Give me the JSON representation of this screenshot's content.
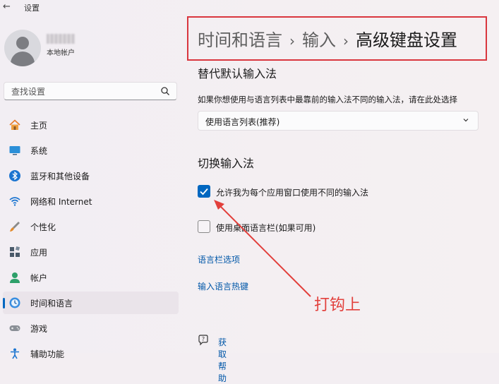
{
  "window": {
    "title": "设置"
  },
  "account": {
    "name": "",
    "type": "本地帐户"
  },
  "search": {
    "placeholder": "查找设置"
  },
  "sidebar": {
    "items": [
      {
        "label": "主页"
      },
      {
        "label": "系统"
      },
      {
        "label": "蓝牙和其他设备"
      },
      {
        "label": "网络和 Internet"
      },
      {
        "label": "个性化"
      },
      {
        "label": "应用"
      },
      {
        "label": "帐户"
      },
      {
        "label": "时间和语言",
        "active": true
      },
      {
        "label": "游戏"
      },
      {
        "label": "辅助功能"
      }
    ]
  },
  "breadcrumb": {
    "items": [
      "时间和语言",
      "输入",
      "高级键盘设置"
    ],
    "separator": "›"
  },
  "override": {
    "title": "替代默认输入法",
    "description": "如果你想使用与语言列表中最靠前的输入法不同的输入法，请在此处选择",
    "selected": "使用语言列表(推荐)"
  },
  "switching": {
    "title": "切换输入法",
    "per_app": {
      "label": "允许我为每个应用窗口使用不同的输入法",
      "checked": true
    },
    "desktop_bar": {
      "label": "使用桌面语言栏(如果可用)",
      "checked": false
    },
    "language_bar_link": "语言栏选项",
    "hotkeys_link": "输入语言热键"
  },
  "help": {
    "label": "获取帮助"
  },
  "annotation": {
    "text": "打钩上"
  },
  "colors": {
    "accent": "#0067c0",
    "annotation": "#e2403c",
    "link": "#0057a8"
  }
}
